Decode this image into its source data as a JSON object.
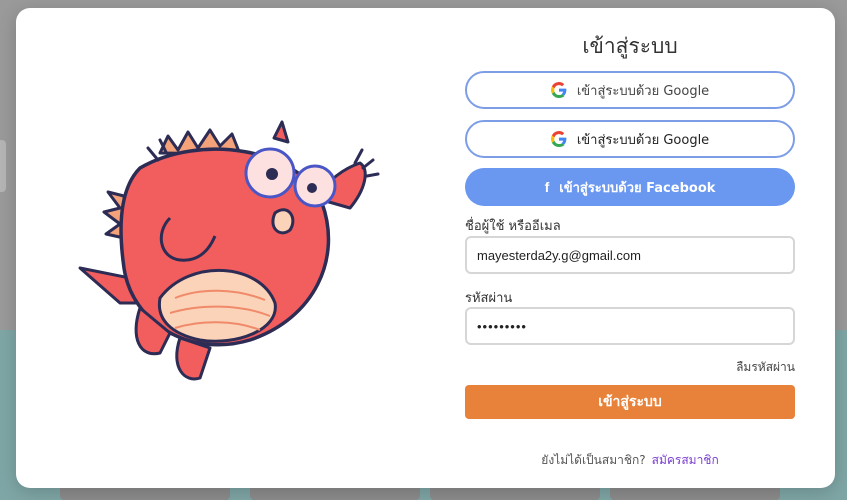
{
  "modal": {
    "title": "เข้าสู่ระบบ",
    "google_button_1": "เข้าสู่ระบบด้วย Google",
    "google_button_2": "เข้าสู่ระบบด้วย Google",
    "facebook_button": "เข้าสู่ระบบด้วย Facebook",
    "facebook_icon": "f",
    "username_label": "ชื่อผู้ใช้ หรืออีเมล",
    "username_value": "mayesterda2y.g@gmail.com",
    "password_label": "รหัสผ่าน",
    "password_value": "•••••••••",
    "forgot_password": "ลืมรหัสผ่าน",
    "login_button": "เข้าสู่ระบบ",
    "signup_prompt": "ยังไม่ได้เป็นสมาชิก?",
    "signup_link": "สมัครสมาชิก"
  },
  "icons": {
    "google": "google-logo-icon",
    "facebook": "facebook-icon",
    "mascot": "dragon-mascot"
  },
  "colors": {
    "google_border": "#7d9ee6",
    "facebook_bg": "#6a97ef",
    "login_bg": "#e8823a",
    "signup_link": "#7b3fd0",
    "mascot_body": "#f25d5d"
  }
}
